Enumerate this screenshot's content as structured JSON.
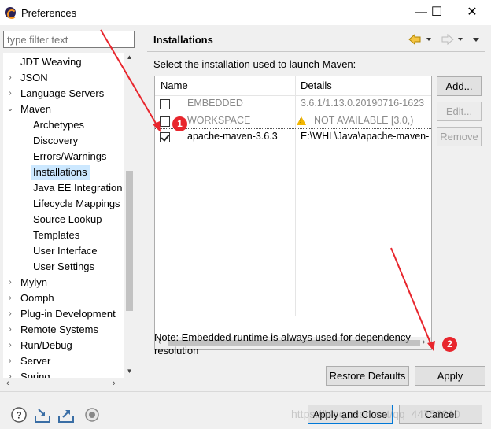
{
  "window": {
    "title": "Preferences",
    "minimize_glyph": "—",
    "maximize_glyph": "☐",
    "close_glyph": "✕"
  },
  "sidebar": {
    "filter_placeholder": "type filter text",
    "items": [
      {
        "label": "JDT Weaving",
        "level": 0,
        "arrow": ""
      },
      {
        "label": "JSON",
        "level": 0,
        "arrow": "›"
      },
      {
        "label": "Language Servers",
        "level": 0,
        "arrow": "›"
      },
      {
        "label": "Maven",
        "level": 0,
        "arrow": "⌄"
      },
      {
        "label": "Archetypes",
        "level": 1,
        "arrow": ""
      },
      {
        "label": "Discovery",
        "level": 1,
        "arrow": ""
      },
      {
        "label": "Errors/Warnings",
        "level": 1,
        "arrow": ""
      },
      {
        "label": "Installations",
        "level": 1,
        "arrow": "",
        "selected": true
      },
      {
        "label": "Java EE Integration",
        "level": 1,
        "arrow": ""
      },
      {
        "label": "Lifecycle Mappings",
        "level": 1,
        "arrow": ""
      },
      {
        "label": "Source Lookup",
        "level": 1,
        "arrow": ""
      },
      {
        "label": "Templates",
        "level": 1,
        "arrow": ""
      },
      {
        "label": "User Interface",
        "level": 1,
        "arrow": ""
      },
      {
        "label": "User Settings",
        "level": 1,
        "arrow": ""
      },
      {
        "label": "Mylyn",
        "level": 0,
        "arrow": "›"
      },
      {
        "label": "Oomph",
        "level": 0,
        "arrow": "›"
      },
      {
        "label": "Plug-in Development",
        "level": 0,
        "arrow": "›"
      },
      {
        "label": "Remote Systems",
        "level": 0,
        "arrow": "›"
      },
      {
        "label": "Run/Debug",
        "level": 0,
        "arrow": "›"
      },
      {
        "label": "Server",
        "level": 0,
        "arrow": "›"
      },
      {
        "label": "Spring",
        "level": 0,
        "arrow": "›"
      }
    ]
  },
  "main": {
    "title": "Installations",
    "intro": "Select the installation used to launch Maven:",
    "table": {
      "columns": [
        "Name",
        "Details"
      ],
      "rows": [
        {
          "checked": false,
          "name": "EMBEDDED",
          "details": "3.6.1/1.13.0.20190716-1623",
          "greyed": true,
          "warning": false
        },
        {
          "checked": false,
          "name": "WORKSPACE",
          "details": "NOT AVAILABLE [3.0,)",
          "greyed": true,
          "warning": true
        },
        {
          "checked": true,
          "name": "apache-maven-3.6.3",
          "details": "E:\\WHL\\Java\\apache-maven-",
          "greyed": false,
          "warning": false
        }
      ]
    },
    "buttons": {
      "add": "Add...",
      "edit": "Edit...",
      "remove": "Remove"
    },
    "note": "Note: Embedded runtime is always used for dependency resolution",
    "restore_defaults": "Restore Defaults",
    "apply": "Apply"
  },
  "footer": {
    "apply_close": "Apply and Close",
    "cancel": "Cancel",
    "watermark": "https://blog.csdn.net/qq_44756810"
  },
  "annotations": {
    "step1": "1",
    "step2": "2"
  },
  "colors": {
    "annotation_red": "#e8262d",
    "selection": "#cce8ff",
    "accent_blue": "#0078d7"
  }
}
